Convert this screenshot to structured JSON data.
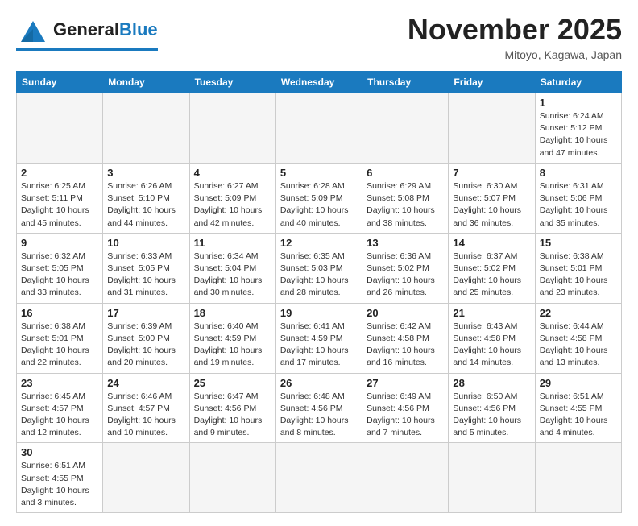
{
  "header": {
    "logo_general": "General",
    "logo_blue": "Blue",
    "title": "November 2025",
    "subtitle": "Mitoyo, Kagawa, Japan"
  },
  "weekdays": [
    "Sunday",
    "Monday",
    "Tuesday",
    "Wednesday",
    "Thursday",
    "Friday",
    "Saturday"
  ],
  "weeks": [
    [
      {
        "day": null,
        "info": null
      },
      {
        "day": null,
        "info": null
      },
      {
        "day": null,
        "info": null
      },
      {
        "day": null,
        "info": null
      },
      {
        "day": null,
        "info": null
      },
      {
        "day": null,
        "info": null
      },
      {
        "day": "1",
        "info": "Sunrise: 6:24 AM\nSunset: 5:12 PM\nDaylight: 10 hours and 47 minutes."
      }
    ],
    [
      {
        "day": "2",
        "info": "Sunrise: 6:25 AM\nSunset: 5:11 PM\nDaylight: 10 hours and 45 minutes."
      },
      {
        "day": "3",
        "info": "Sunrise: 6:26 AM\nSunset: 5:10 PM\nDaylight: 10 hours and 44 minutes."
      },
      {
        "day": "4",
        "info": "Sunrise: 6:27 AM\nSunset: 5:09 PM\nDaylight: 10 hours and 42 minutes."
      },
      {
        "day": "5",
        "info": "Sunrise: 6:28 AM\nSunset: 5:09 PM\nDaylight: 10 hours and 40 minutes."
      },
      {
        "day": "6",
        "info": "Sunrise: 6:29 AM\nSunset: 5:08 PM\nDaylight: 10 hours and 38 minutes."
      },
      {
        "day": "7",
        "info": "Sunrise: 6:30 AM\nSunset: 5:07 PM\nDaylight: 10 hours and 36 minutes."
      },
      {
        "day": "8",
        "info": "Sunrise: 6:31 AM\nSunset: 5:06 PM\nDaylight: 10 hours and 35 minutes."
      }
    ],
    [
      {
        "day": "9",
        "info": "Sunrise: 6:32 AM\nSunset: 5:05 PM\nDaylight: 10 hours and 33 minutes."
      },
      {
        "day": "10",
        "info": "Sunrise: 6:33 AM\nSunset: 5:05 PM\nDaylight: 10 hours and 31 minutes."
      },
      {
        "day": "11",
        "info": "Sunrise: 6:34 AM\nSunset: 5:04 PM\nDaylight: 10 hours and 30 minutes."
      },
      {
        "day": "12",
        "info": "Sunrise: 6:35 AM\nSunset: 5:03 PM\nDaylight: 10 hours and 28 minutes."
      },
      {
        "day": "13",
        "info": "Sunrise: 6:36 AM\nSunset: 5:02 PM\nDaylight: 10 hours and 26 minutes."
      },
      {
        "day": "14",
        "info": "Sunrise: 6:37 AM\nSunset: 5:02 PM\nDaylight: 10 hours and 25 minutes."
      },
      {
        "day": "15",
        "info": "Sunrise: 6:38 AM\nSunset: 5:01 PM\nDaylight: 10 hours and 23 minutes."
      }
    ],
    [
      {
        "day": "16",
        "info": "Sunrise: 6:38 AM\nSunset: 5:01 PM\nDaylight: 10 hours and 22 minutes."
      },
      {
        "day": "17",
        "info": "Sunrise: 6:39 AM\nSunset: 5:00 PM\nDaylight: 10 hours and 20 minutes."
      },
      {
        "day": "18",
        "info": "Sunrise: 6:40 AM\nSunset: 4:59 PM\nDaylight: 10 hours and 19 minutes."
      },
      {
        "day": "19",
        "info": "Sunrise: 6:41 AM\nSunset: 4:59 PM\nDaylight: 10 hours and 17 minutes."
      },
      {
        "day": "20",
        "info": "Sunrise: 6:42 AM\nSunset: 4:58 PM\nDaylight: 10 hours and 16 minutes."
      },
      {
        "day": "21",
        "info": "Sunrise: 6:43 AM\nSunset: 4:58 PM\nDaylight: 10 hours and 14 minutes."
      },
      {
        "day": "22",
        "info": "Sunrise: 6:44 AM\nSunset: 4:58 PM\nDaylight: 10 hours and 13 minutes."
      }
    ],
    [
      {
        "day": "23",
        "info": "Sunrise: 6:45 AM\nSunset: 4:57 PM\nDaylight: 10 hours and 12 minutes."
      },
      {
        "day": "24",
        "info": "Sunrise: 6:46 AM\nSunset: 4:57 PM\nDaylight: 10 hours and 10 minutes."
      },
      {
        "day": "25",
        "info": "Sunrise: 6:47 AM\nSunset: 4:56 PM\nDaylight: 10 hours and 9 minutes."
      },
      {
        "day": "26",
        "info": "Sunrise: 6:48 AM\nSunset: 4:56 PM\nDaylight: 10 hours and 8 minutes."
      },
      {
        "day": "27",
        "info": "Sunrise: 6:49 AM\nSunset: 4:56 PM\nDaylight: 10 hours and 7 minutes."
      },
      {
        "day": "28",
        "info": "Sunrise: 6:50 AM\nSunset: 4:56 PM\nDaylight: 10 hours and 5 minutes."
      },
      {
        "day": "29",
        "info": "Sunrise: 6:51 AM\nSunset: 4:55 PM\nDaylight: 10 hours and 4 minutes."
      }
    ],
    [
      {
        "day": "30",
        "info": "Sunrise: 6:51 AM\nSunset: 4:55 PM\nDaylight: 10 hours and 3 minutes."
      },
      {
        "day": null,
        "info": null
      },
      {
        "day": null,
        "info": null
      },
      {
        "day": null,
        "info": null
      },
      {
        "day": null,
        "info": null
      },
      {
        "day": null,
        "info": null
      },
      {
        "day": null,
        "info": null
      }
    ]
  ]
}
